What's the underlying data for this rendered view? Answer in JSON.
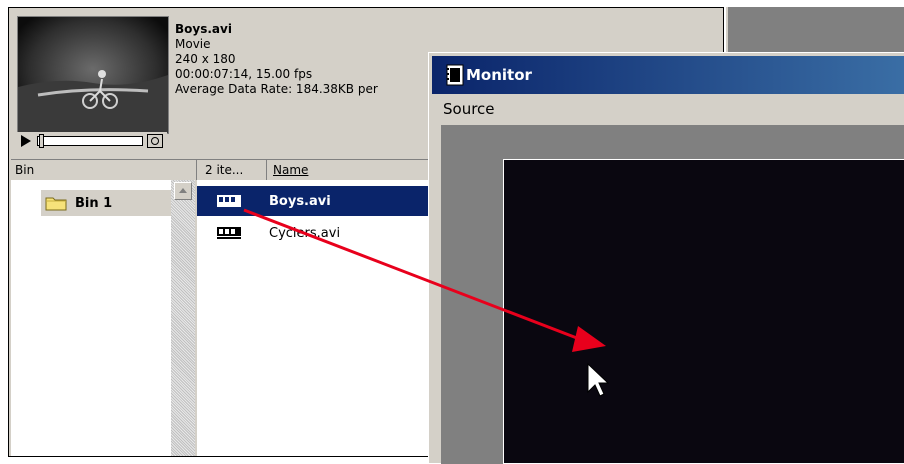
{
  "clip_info": {
    "name": "Boys.avi",
    "type": "Movie",
    "dimensions": "240 x 180",
    "duration_fps": "00:00:07:14, 15.00 fps",
    "data_rate": "Average Data Rate: 184.38KB per"
  },
  "columns": {
    "bin": "Bin",
    "items": "2 ite...",
    "name": "Name"
  },
  "bins": [
    {
      "label": "Bin 1"
    }
  ],
  "clips": [
    {
      "name": "Boys.avi",
      "selected": true
    },
    {
      "name": "Cyclers.avi",
      "selected": false
    }
  ],
  "monitor": {
    "title": "Monitor",
    "tab": "Source"
  },
  "colors": {
    "selection": "#0a246a",
    "arrow": "#e8001c",
    "video_bg": "#0a0710"
  },
  "icons": [
    "play-icon",
    "poster-frame-icon",
    "folder-icon",
    "film-clip-icon",
    "monitor-icon",
    "mouse-cursor-icon",
    "drag-arrow"
  ]
}
